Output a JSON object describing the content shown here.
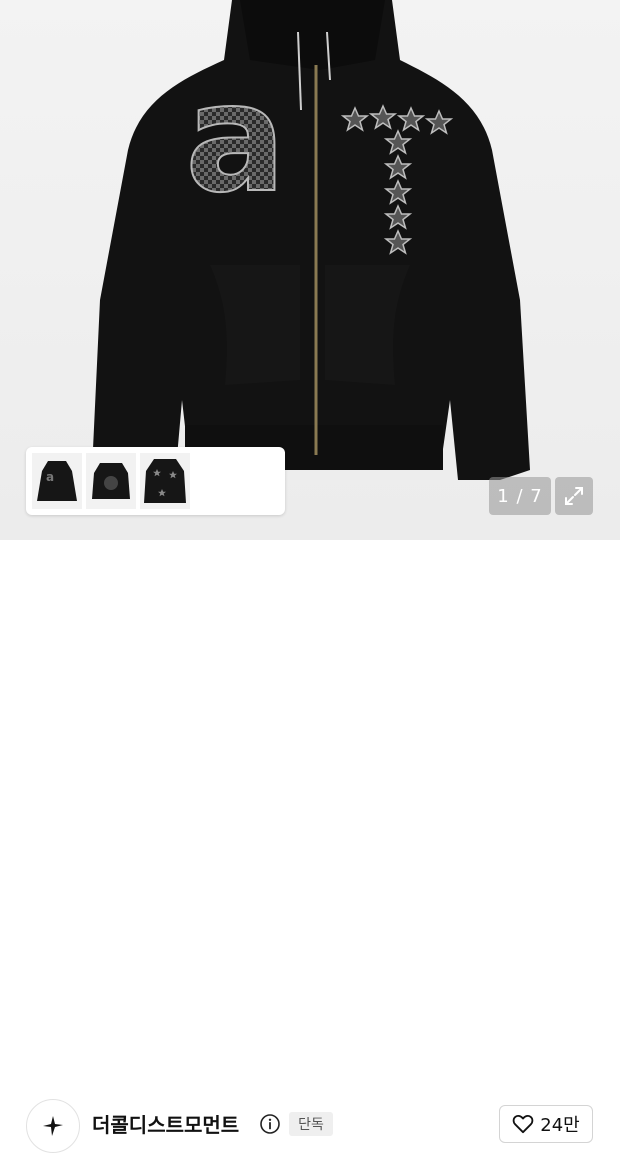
{
  "gallery": {
    "counter": "1 / 7",
    "current_index": 1,
    "total_images": 7,
    "thumbnails": [
      {
        "name": "thumbnail-1"
      },
      {
        "name": "thumbnail-2"
      },
      {
        "name": "thumbnail-3"
      }
    ],
    "expand_icon": "expand-arrows-icon"
  },
  "brand": {
    "name": "더콜디스트모먼트",
    "badge": "단독",
    "info_icon": "info-icon",
    "logo_icon": "star-logo-icon"
  },
  "like": {
    "count": "24만",
    "icon": "heart-outline-icon"
  },
  "colors": {
    "hoodie": "#111111",
    "accent_gray": "#8a8a8a",
    "badge_bg": "#efefef"
  }
}
